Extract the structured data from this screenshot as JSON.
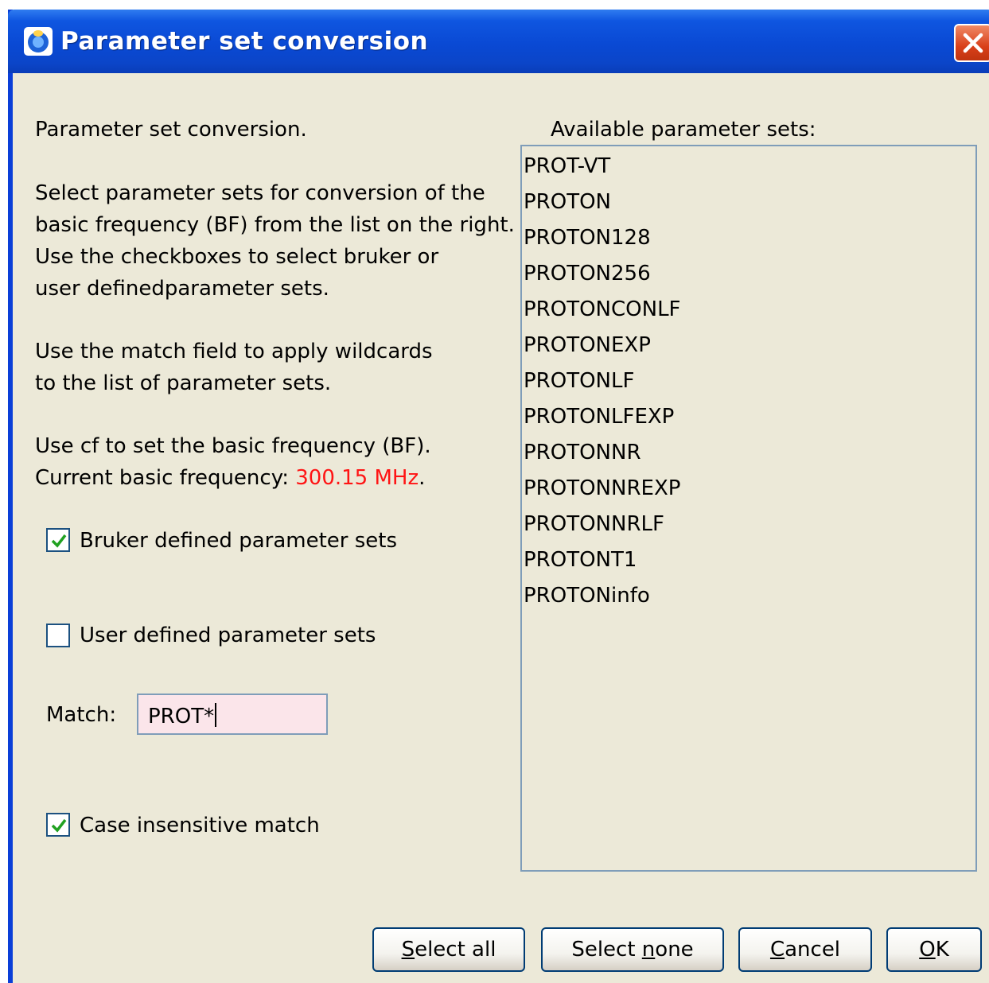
{
  "window": {
    "title": "Parameter set conversion"
  },
  "left": {
    "heading": "Parameter set conversion.",
    "para1": [
      "Select parameter sets for conversion of the",
      "basic frequency (BF) from the list on the right.",
      "Use the checkboxes to select bruker or",
      "user definedparameter sets."
    ],
    "para2": [
      "Use the match field to apply wildcards",
      "to the list of parameter sets."
    ],
    "para3_line1": "Use cf to set the basic frequency (BF).",
    "para3_line2_prefix": "Current basic frequency: ",
    "frequency": "300.15 MHz",
    "para3_line2_suffix": "."
  },
  "options": {
    "bruker_label": "Bruker defined parameter sets",
    "bruker_checked": true,
    "user_label": "User defined parameter sets",
    "user_checked": false,
    "match_label": "Match:",
    "match_value": "PROT*",
    "case_label": "Case insensitive match",
    "case_checked": true
  },
  "list": {
    "label": "Available parameter sets:",
    "items": [
      "PROT-VT",
      "PROTON",
      "PROTON128",
      "PROTON256",
      "PROTONCONLF",
      "PROTONEXP",
      "PROTONLF",
      "PROTONLFEXP",
      "PROTONNR",
      "PROTONNREXP",
      "PROTONNRLF",
      "PROTONT1",
      "PROTONinfo"
    ]
  },
  "buttons": {
    "select_all": {
      "mnemonic": "S",
      "rest": "elect all"
    },
    "select_none": {
      "before": "Select ",
      "mnemonic": "n",
      "rest": "one"
    },
    "cancel": {
      "mnemonic": "C",
      "rest": "ancel"
    },
    "ok": {
      "mnemonic": "O",
      "rest": "K"
    }
  },
  "colors": {
    "accent_red": "#ff1414",
    "title_blue": "#0a49d4"
  }
}
